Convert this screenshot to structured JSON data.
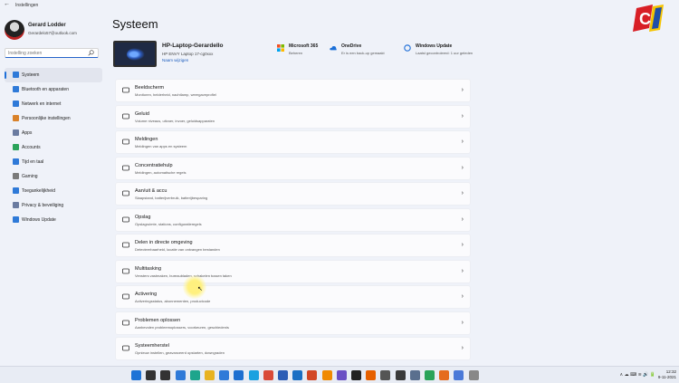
{
  "window": {
    "title": "Instellingen",
    "back_icon": "back-arrow-icon"
  },
  "profile": {
    "name": "Gerard Lodder",
    "email": "Gerardelo57@outlook.com"
  },
  "search": {
    "placeholder": "Instelling zoeken"
  },
  "sidebar": {
    "items": [
      {
        "label": "Systeem",
        "icon": "system-icon",
        "color": "#2f7ad8",
        "active": true
      },
      {
        "label": "Bluetooth en apparaten",
        "icon": "bluetooth-icon",
        "color": "#2f7ad8"
      },
      {
        "label": "Netwerk en internet",
        "icon": "wifi-icon",
        "color": "#2f7ad8"
      },
      {
        "label": "Persoonlijke instellingen",
        "icon": "brush-icon",
        "color": "#d9822b"
      },
      {
        "label": "Apps",
        "icon": "apps-icon",
        "color": "#6a7ba0"
      },
      {
        "label": "Accounts",
        "icon": "person-icon",
        "color": "#2aa35a"
      },
      {
        "label": "Tijd en taal",
        "icon": "globe-clock-icon",
        "color": "#2f7ad8"
      },
      {
        "label": "Gaming",
        "icon": "gamepad-icon",
        "color": "#7a7a7a"
      },
      {
        "label": "Toegankelijkheid",
        "icon": "accessibility-icon",
        "color": "#2f7ad8"
      },
      {
        "label": "Privacy & beveiliging",
        "icon": "shield-icon",
        "color": "#6a7ba0"
      },
      {
        "label": "Windows Update",
        "icon": "windows-update-icon",
        "color": "#2f7ad8"
      }
    ]
  },
  "main": {
    "title": "Systeem",
    "device": {
      "name": "HP-Laptop-Gerardello",
      "model": "HP ENVY Laptop 17-cg0xxx",
      "rename": "Naam wijzigen"
    },
    "services": [
      {
        "title": "Microsoft 365",
        "sub": "Beheren",
        "icon": "microsoft-icon"
      },
      {
        "title": "OneDrive",
        "sub": "Er is een back-up gemaakt",
        "icon": "onedrive-icon"
      },
      {
        "title": "Windows Update",
        "sub": "Laatst gecontroleerd: 1 uur geleden",
        "icon": "windows-update-icon"
      }
    ],
    "cards": [
      {
        "title": "Beeldscherm",
        "sub": "Monitoren, helderheid, nachtlamp, weergaveprofiel",
        "icon": "display-icon"
      },
      {
        "title": "Geluid",
        "sub": "Volume niveaus, uitvoer, invoer, geluidsapparaten",
        "icon": "speaker-icon"
      },
      {
        "title": "Meldingen",
        "sub": "Meldingen van apps en systeem",
        "icon": "bell-icon"
      },
      {
        "title": "Concentratiehulp",
        "sub": "Meldingen, automatische regels",
        "icon": "moon-icon"
      },
      {
        "title": "Aan/uit & accu",
        "sub": "Slaapstand, batterijverbruik, batterijbesparing",
        "icon": "power-icon"
      },
      {
        "title": "Opslag",
        "sub": "Opslagruimte, stations, configuratieregels",
        "icon": "storage-icon"
      },
      {
        "title": "Delen in directe omgeving",
        "sub": "Detecteerbaarheid, locatie van ontvangen bestanden",
        "icon": "share-icon"
      },
      {
        "title": "Multitasking",
        "sub": "Vensters vastmaken, bureaubladen, schakelen tussen taken",
        "icon": "multitask-icon"
      },
      {
        "title": "Activering",
        "sub": "Activeringsstatus, abonnementen, productcode",
        "icon": "check-circle-icon"
      },
      {
        "title": "Problemen oplossen",
        "sub": "Aanbevolen probleemoplossers, voorkeuren, geschiedenis",
        "icon": "wrench-icon"
      },
      {
        "title": "Systeemherstel",
        "sub": "Opnieuw instellen, geavanceerd opstarten, downgraden",
        "icon": "recovery-icon"
      }
    ]
  },
  "taskbar": {
    "icons": [
      {
        "name": "start-icon",
        "color": "#1e73d6"
      },
      {
        "name": "search-icon",
        "color": "#333333"
      },
      {
        "name": "task-view-icon",
        "color": "#333333"
      },
      {
        "name": "widgets-icon",
        "color": "#2f7ad8"
      },
      {
        "name": "edge-icon",
        "color": "#1da58c"
      },
      {
        "name": "file-explorer-icon",
        "color": "#e8b321"
      },
      {
        "name": "store-icon",
        "color": "#2f7ad8"
      },
      {
        "name": "mail-icon",
        "color": "#1e6fd0"
      },
      {
        "name": "skype-icon",
        "color": "#1aa1e0"
      },
      {
        "name": "chrome-icon",
        "color": "#d94a38"
      },
      {
        "name": "word-icon",
        "color": "#2b5cb5"
      },
      {
        "name": "outlook-icon",
        "color": "#1a6fc4"
      },
      {
        "name": "powerpoint-icon",
        "color": "#d24726"
      },
      {
        "name": "vlc-icon",
        "color": "#f08a00"
      },
      {
        "name": "app-icon",
        "color": "#6a4fc4"
      },
      {
        "name": "camera-icon",
        "color": "#222222"
      },
      {
        "name": "firefox-icon",
        "color": "#e66000"
      },
      {
        "name": "headset-icon",
        "color": "#555555"
      },
      {
        "name": "app2-icon",
        "color": "#3a3a3a"
      },
      {
        "name": "settings-icon",
        "color": "#5a6f8e"
      },
      {
        "name": "c-app-icon",
        "color": "#2aa35a"
      },
      {
        "name": "c-app-icon-2",
        "color": "#e56b1f"
      },
      {
        "name": "app3-icon",
        "color": "#4a79d8"
      },
      {
        "name": "app4-icon",
        "color": "#888888"
      }
    ],
    "tray": "∧  ☁  ⌨  ≋  🔊  🔋",
    "time": "12:32",
    "date": "9-11-2021"
  },
  "overlay": {
    "logo_letters": "C"
  }
}
